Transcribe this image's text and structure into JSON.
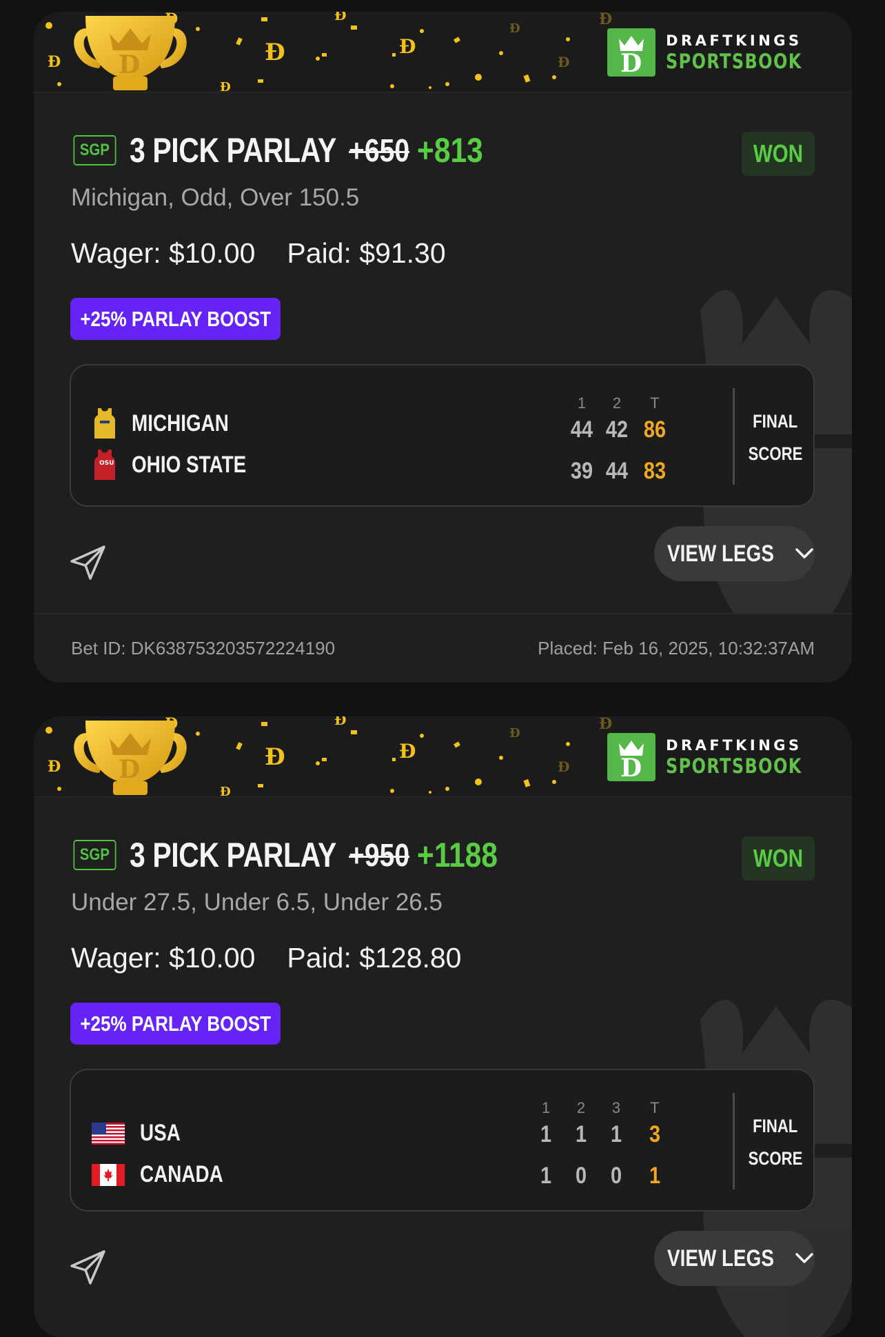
{
  "brand": {
    "line1": "DRAFTKINGS",
    "line2": "SPORTSBOOK",
    "accent": "#53b848"
  },
  "cards": [
    {
      "sgp": "SGP",
      "title": "3 PICK PARLAY",
      "odds_original": "+650",
      "odds_boosted": "+813",
      "status": "WON",
      "legs": "Michigan, Odd, Over 150.5",
      "wager": "Wager: $10.00",
      "paid": "Paid: $91.30",
      "boost": "+25% PARLAY BOOST",
      "periods": [
        "1",
        "2",
        "T"
      ],
      "teams": [
        {
          "name": "MICHIGAN",
          "icon": "jersey-icon",
          "scores": [
            "44",
            "42"
          ],
          "total": "86"
        },
        {
          "name": "OHIO STATE",
          "icon": "jersey-icon",
          "scores": [
            "39",
            "44"
          ],
          "total": "83"
        }
      ],
      "final_l1": "FINAL",
      "final_l2": "SCORE",
      "view_legs": "VIEW LEGS",
      "bet_id": "Bet ID: DK638753203572224190",
      "placed": "Placed: Feb 16, 2025, 10:32:37AM"
    },
    {
      "sgp": "SGP",
      "title": "3 PICK PARLAY",
      "odds_original": "+950",
      "odds_boosted": "+1188",
      "status": "WON",
      "legs": "Under 27.5, Under 6.5, Under 26.5",
      "wager": "Wager: $10.00",
      "paid": "Paid: $128.80",
      "boost": "+25% PARLAY BOOST",
      "periods": [
        "1",
        "2",
        "3",
        "T"
      ],
      "teams": [
        {
          "name": "USA",
          "icon": "us-flag-icon",
          "scores": [
            "1",
            "1",
            "1"
          ],
          "total": "3"
        },
        {
          "name": "CANADA",
          "icon": "canada-flag-icon",
          "scores": [
            "1",
            "0",
            "0"
          ],
          "total": "1"
        }
      ],
      "final_l1": "FINAL",
      "final_l2": "SCORE",
      "view_legs": "VIEW LEGS"
    }
  ]
}
